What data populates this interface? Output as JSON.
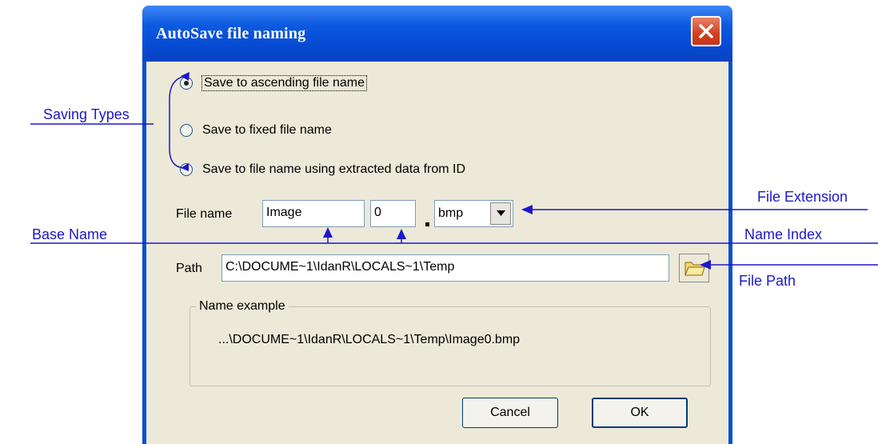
{
  "dialog": {
    "title": "AutoSave file naming",
    "saving_options": [
      {
        "label": "Save to ascending file name",
        "selected": true
      },
      {
        "label": "Save to fixed file name",
        "selected": false
      },
      {
        "label": "Save to file name  using extracted data from ID",
        "selected": false
      }
    ],
    "file_name": {
      "label": "File name",
      "base_value": "Image",
      "index_value": "0",
      "extension_value": "bmp"
    },
    "path": {
      "label": "Path",
      "value": "C:\\DOCUME~1\\IdanR\\LOCALS~1\\Temp"
    },
    "name_example": {
      "title": "Name example",
      "value": "...\\DOCUME~1\\IdanR\\LOCALS~1\\Temp\\Image0.bmp"
    },
    "buttons": {
      "cancel": "Cancel",
      "ok": "OK"
    }
  },
  "annotations": {
    "saving_types": "Saving Types",
    "base_name": "Base Name",
    "file_extension": "File Extension",
    "name_index": "Name Index",
    "file_path": "File Path"
  },
  "colors": {
    "annotation": "#1d17c8",
    "titlebar": "#0a4fcf",
    "dialog_face": "#ece9d8"
  }
}
